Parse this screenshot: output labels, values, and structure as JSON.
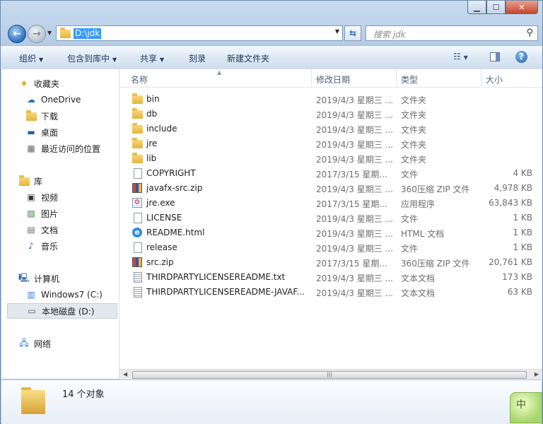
{
  "window": {
    "caption": {
      "min": "▁",
      "max": "☐",
      "close": "✕"
    }
  },
  "address": {
    "path": "D:\\jdk",
    "search_placeholder": "搜索 jdk"
  },
  "toolbar": {
    "organize": "组织",
    "include_in_library": "包含到库中",
    "share": "共享",
    "burn": "刻录",
    "new_folder": "新建文件夹"
  },
  "sidebar": {
    "favorites": {
      "label": "收藏夹",
      "items": [
        "OneDrive",
        "下载",
        "桌面",
        "最近访问的位置"
      ]
    },
    "libraries": {
      "label": "库",
      "items": [
        "视频",
        "图片",
        "文档",
        "音乐"
      ]
    },
    "computer": {
      "label": "计算机",
      "items": [
        "Windows7 (C:)",
        "本地磁盘 (D:)"
      ]
    },
    "network": {
      "label": "网络"
    }
  },
  "columns": {
    "name": "名称",
    "date": "修改日期",
    "type": "类型",
    "size": "大小"
  },
  "files": [
    {
      "name": "bin",
      "date": "2019/4/3 星期三 ...",
      "type": "文件夹",
      "size": "",
      "icon": "folder"
    },
    {
      "name": "db",
      "date": "2019/4/3 星期三 ...",
      "type": "文件夹",
      "size": "",
      "icon": "folder"
    },
    {
      "name": "include",
      "date": "2019/4/3 星期三 ...",
      "type": "文件夹",
      "size": "",
      "icon": "folder"
    },
    {
      "name": "jre",
      "date": "2019/4/3 星期三 ...",
      "type": "文件夹",
      "size": "",
      "icon": "folder"
    },
    {
      "name": "lib",
      "date": "2019/4/3 星期三 ...",
      "type": "文件夹",
      "size": "",
      "icon": "folder"
    },
    {
      "name": "COPYRIGHT",
      "date": "2017/3/15 星期...",
      "type": "文件",
      "size": "4 KB",
      "icon": "document"
    },
    {
      "name": "javafx-src.zip",
      "date": "2019/4/3 星期三 ...",
      "type": "360压缩 ZIP 文件",
      "size": "4,978 KB",
      "icon": "zip"
    },
    {
      "name": "jre.exe",
      "date": "2017/3/15 星期...",
      "type": "应用程序",
      "size": "63,843 KB",
      "icon": "exe"
    },
    {
      "name": "LICENSE",
      "date": "2019/4/3 星期三 ...",
      "type": "文件",
      "size": "1 KB",
      "icon": "document"
    },
    {
      "name": "README.html",
      "date": "2019/4/3 星期三 ...",
      "type": "HTML 文档",
      "size": "1 KB",
      "icon": "ie"
    },
    {
      "name": "release",
      "date": "2019/4/3 星期三 ...",
      "type": "文件",
      "size": "1 KB",
      "icon": "document"
    },
    {
      "name": "src.zip",
      "date": "2017/3/15 星期...",
      "type": "360压缩 ZIP 文件",
      "size": "20,761 KB",
      "icon": "zip"
    },
    {
      "name": "THIRDPARTYLICENSEREADME.txt",
      "date": "2019/4/3 星期三 ...",
      "type": "文本文档",
      "size": "173 KB",
      "icon": "text"
    },
    {
      "name": "THIRDPARTYLICENSEREADME-JAVAF...",
      "date": "2019/4/3 星期三 ...",
      "type": "文本文档",
      "size": "63 KB",
      "icon": "text"
    }
  ],
  "status": {
    "count": "14 个对象"
  },
  "ime": {
    "label": "中"
  }
}
